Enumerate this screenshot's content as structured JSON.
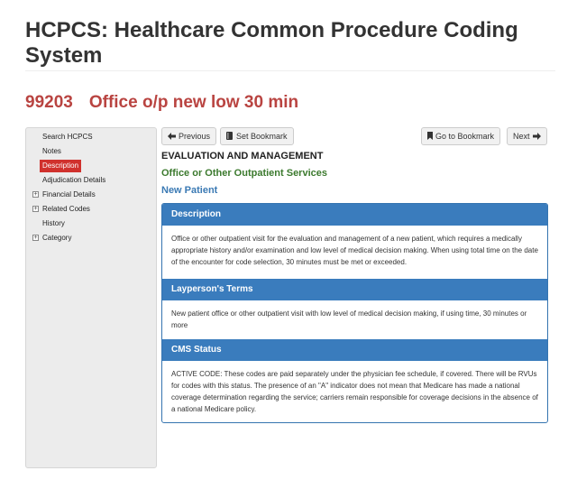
{
  "header": {
    "title": "HCPCS: Healthcare Common Procedure Coding System",
    "code": "99203",
    "code_desc": "Office o/p new low 30 min"
  },
  "sidebar": {
    "items": [
      {
        "label": "Search HCPCS",
        "expandable": false,
        "active": false
      },
      {
        "label": "Notes",
        "expandable": false,
        "active": false
      },
      {
        "label": "Description",
        "expandable": false,
        "active": true
      },
      {
        "label": "Adjudication Details",
        "expandable": false,
        "active": false
      },
      {
        "label": "Financial Details",
        "expandable": true,
        "active": false
      },
      {
        "label": "Related Codes",
        "expandable": true,
        "active": false
      },
      {
        "label": "History",
        "expandable": false,
        "active": false
      },
      {
        "label": "Category",
        "expandable": true,
        "active": false
      }
    ],
    "active_color": "#d0312d"
  },
  "toolbar": {
    "previous_label": "Previous",
    "set_bookmark_label": "Set Bookmark",
    "go_bookmark_label": "Go to Bookmark",
    "next_label": "Next"
  },
  "category": {
    "level1": "EVALUATION AND MANAGEMENT",
    "level2": "Office or Other Outpatient Services",
    "level3": "New Patient"
  },
  "panels": {
    "description": {
      "title": "Description",
      "body": "Office or other outpatient visit for the evaluation and management of a new patient, which requires a medically appropriate history and/or examination and low level of medical decision making. When using total time on the date of the encounter for code selection, 30 minutes must be met or exceeded."
    },
    "layperson": {
      "title": "Layperson's Terms",
      "body": "New patient office or other outpatient visit with low level of medical decision making, if using time, 30 minutes or more"
    },
    "cms_status": {
      "title": "CMS Status",
      "body": "ACTIVE CODE: These codes are paid separately under the physician fee schedule, if covered. There will be RVUs for codes with this status. The presence of an \"A\" indicator does not mean that Medicare has made a national coverage determination regarding the service; carriers remain responsible for coverage decisions in the absence of a national Medicare policy."
    }
  },
  "colors": {
    "code_heading": "#b94441",
    "panel_header": "#3a7cbd",
    "category_green": "#3c7a2e",
    "category_blue": "#3b7ab4"
  }
}
